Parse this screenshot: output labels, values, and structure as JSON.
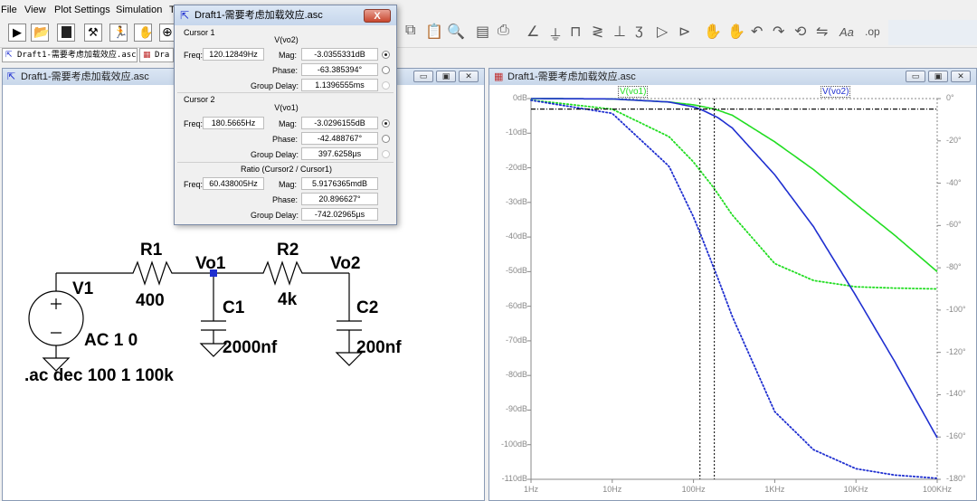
{
  "menu": {
    "file": "File",
    "view": "View",
    "plot_settings": "Plot Settings",
    "simulation": "Simulation",
    "tools": "T"
  },
  "tabs": {
    "tab1": "Draft1-需要考虑加载效应.asc",
    "tab2": "Dra"
  },
  "schematic_window": {
    "title": "Draft1-需要考虑加载效应.asc"
  },
  "plot_window": {
    "title": "Draft1-需要考虑加载效应.asc"
  },
  "cursor_dialog": {
    "title": "Draft1-需要考虑加载效应.asc",
    "close": "X",
    "cursor1": {
      "header": "Cursor 1",
      "trace": "V(vo2)",
      "freq_label": "Freq:",
      "freq": "120.12849Hz",
      "mag_label": "Mag:",
      "mag": "-3.0355331dB",
      "phase_label": "Phase:",
      "phase": "-63.385394°",
      "gd_label": "Group Delay:",
      "gd": "1.1396555ms"
    },
    "cursor2": {
      "header": "Cursor 2",
      "trace": "V(vo1)",
      "freq_label": "Freq:",
      "freq": "180.5665Hz",
      "mag_label": "Mag:",
      "mag": "-3.0296155dB",
      "phase_label": "Phase:",
      "phase": "-42.488767°",
      "gd_label": "Group Delay:",
      "gd": "397.6258µs"
    },
    "ratio": {
      "header": "Ratio (Cursor2 / Cursor1)",
      "freq_label": "Freq:",
      "freq": "60.438005Hz",
      "mag_label": "Mag:",
      "mag": "5.9176365mdB",
      "phase_label": "Phase:",
      "phase": "20.896627°",
      "gd_label": "Group Delay:",
      "gd": "-742.02965µs"
    }
  },
  "schematic": {
    "r1": "R1",
    "r1_val": "400",
    "r2": "R2",
    "r2_val": "4k",
    "c1": "C1",
    "c1_val": "2000nf",
    "c2": "C2",
    "c2_val": "200nf",
    "v1": "V1",
    "v1_val": "AC 1 0",
    "vo1": "Vo1",
    "vo2": "Vo2",
    "directive": ".ac dec 100 1 100k"
  },
  "colors": {
    "vo1": "#22dd22",
    "vo2": "#1f2fd0",
    "grid": "#808080"
  },
  "chart_data": {
    "type": "line",
    "xscale": "log",
    "xlim": [
      1,
      100000
    ],
    "ylim": [
      -110,
      0
    ],
    "y2lim": [
      -180,
      0
    ],
    "x_ticks": [
      "1Hz",
      "10Hz",
      "100Hz",
      "1KHz",
      "10KHz",
      "100KHz"
    ],
    "y_ticks": [
      "0dB",
      "-10dB",
      "-20dB",
      "-30dB",
      "-40dB",
      "-50dB",
      "-60dB",
      "-70dB",
      "-80dB",
      "-90dB",
      "-100dB",
      "-110dB"
    ],
    "y2_ticks": [
      "0°",
      "-20°",
      "-40°",
      "-60°",
      "-80°",
      "-100°",
      "-120°",
      "-140°",
      "-160°",
      "-180°"
    ],
    "grid": "right-and-top-border",
    "series": [
      {
        "name": "V(vo1)",
        "color": "#22dd22",
        "freq": [
          1,
          10,
          50,
          100,
          180,
          300,
          1000,
          3000,
          10000,
          30000,
          100000
        ],
        "mag_db": [
          0,
          -0.1,
          -1,
          -1.8,
          -3.0,
          -4.8,
          -12.5,
          -20.5,
          -30.5,
          -39.5,
          -50
        ],
        "phase_deg": [
          -0.7,
          -5,
          -18,
          -30,
          -42.5,
          -55,
          -78,
          -86,
          -89,
          -89.6,
          -90
        ]
      },
      {
        "name": "V(vo2)",
        "color": "#1f2fd0",
        "freq": [
          1,
          10,
          50,
          100,
          120,
          200,
          300,
          1000,
          3000,
          10000,
          30000,
          100000
        ],
        "mag_db": [
          0,
          -0.1,
          -1,
          -2.4,
          -3.0,
          -5.5,
          -8.5,
          -22,
          -37,
          -57,
          -76,
          -98
        ],
        "phase_deg": [
          -0.8,
          -7,
          -32,
          -56,
          -63.4,
          -85,
          -103,
          -148,
          -166,
          -175,
          -178,
          -179.5
        ]
      }
    ],
    "cursors": [
      {
        "freq": 120.12849,
        "mag_db": -3.0355331
      },
      {
        "freq": 180.5665,
        "mag_db": -3.0296155
      }
    ]
  }
}
